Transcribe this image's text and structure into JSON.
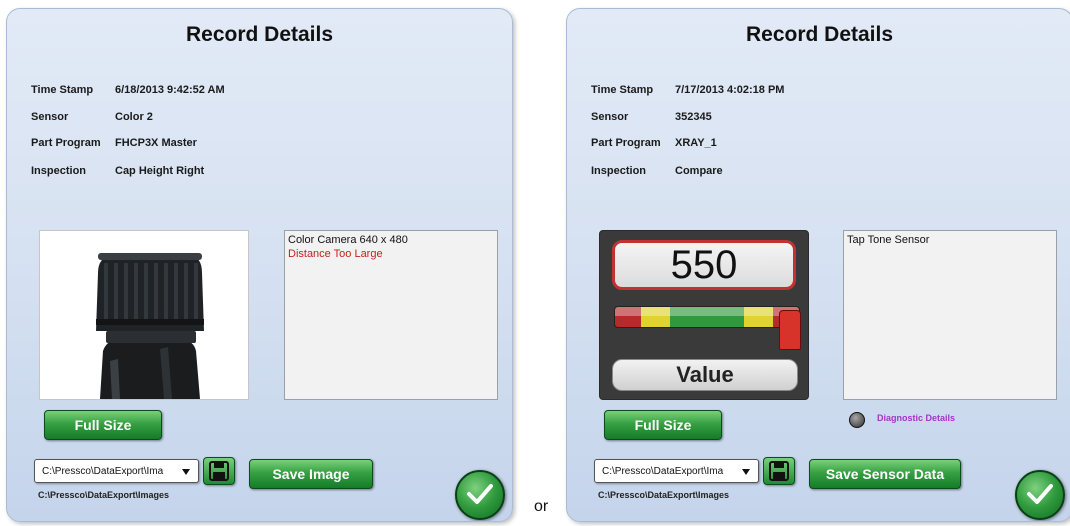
{
  "left_panel": {
    "title": "Record Details",
    "fields": [
      {
        "label": "Time Stamp",
        "value": "6/18/2013 9:42:52 AM"
      },
      {
        "label": "Sensor",
        "value": "Color 2"
      },
      {
        "label": "Part Program",
        "value": "FHCP3X Master"
      },
      {
        "label": "Inspection",
        "value": "Cap Height Right"
      }
    ],
    "info_lines": [
      "Color Camera 640 x 480"
    ],
    "error_line": "Distance Too Large",
    "full_size_label": "Full Size",
    "path_combo_value": "C:\\Pressco\\DataExport\\Ima",
    "save_label": "Save Image",
    "path_text": "C:\\Pressco\\DataExport\\Images",
    "image_icon": "bottle-cap-photo"
  },
  "right_panel": {
    "title": "Record Details",
    "fields": [
      {
        "label": "Time Stamp",
        "value": "7/17/2013 4:02:18 PM"
      },
      {
        "label": "Sensor",
        "value": "352345"
      },
      {
        "label": "Part Program",
        "value": "XRAY_1"
      },
      {
        "label": "Inspection",
        "value": "Compare"
      }
    ],
    "info_lines": [
      "Tap Tone Sensor"
    ],
    "gauge_value": "550",
    "gauge_label": "Value",
    "full_size_label": "Full Size",
    "diagnostic_label": "Diagnostic Details",
    "path_combo_value": "C:\\Pressco\\DataExport\\Ima",
    "save_label": "Save Sensor Data",
    "path_text": "C:\\Pressco\\DataExport\\Images"
  },
  "separator_text": "or",
  "colors": {
    "accent_green": "#2f9a3d",
    "error_red": "#c0221c",
    "diagnostic_purple": "#a235c8",
    "panel_blue": "#d4e0f1"
  },
  "icons": {
    "save": "floppy-disk-icon",
    "ok": "checkmark-icon",
    "dropdown": "dropdown-arrow-icon"
  }
}
